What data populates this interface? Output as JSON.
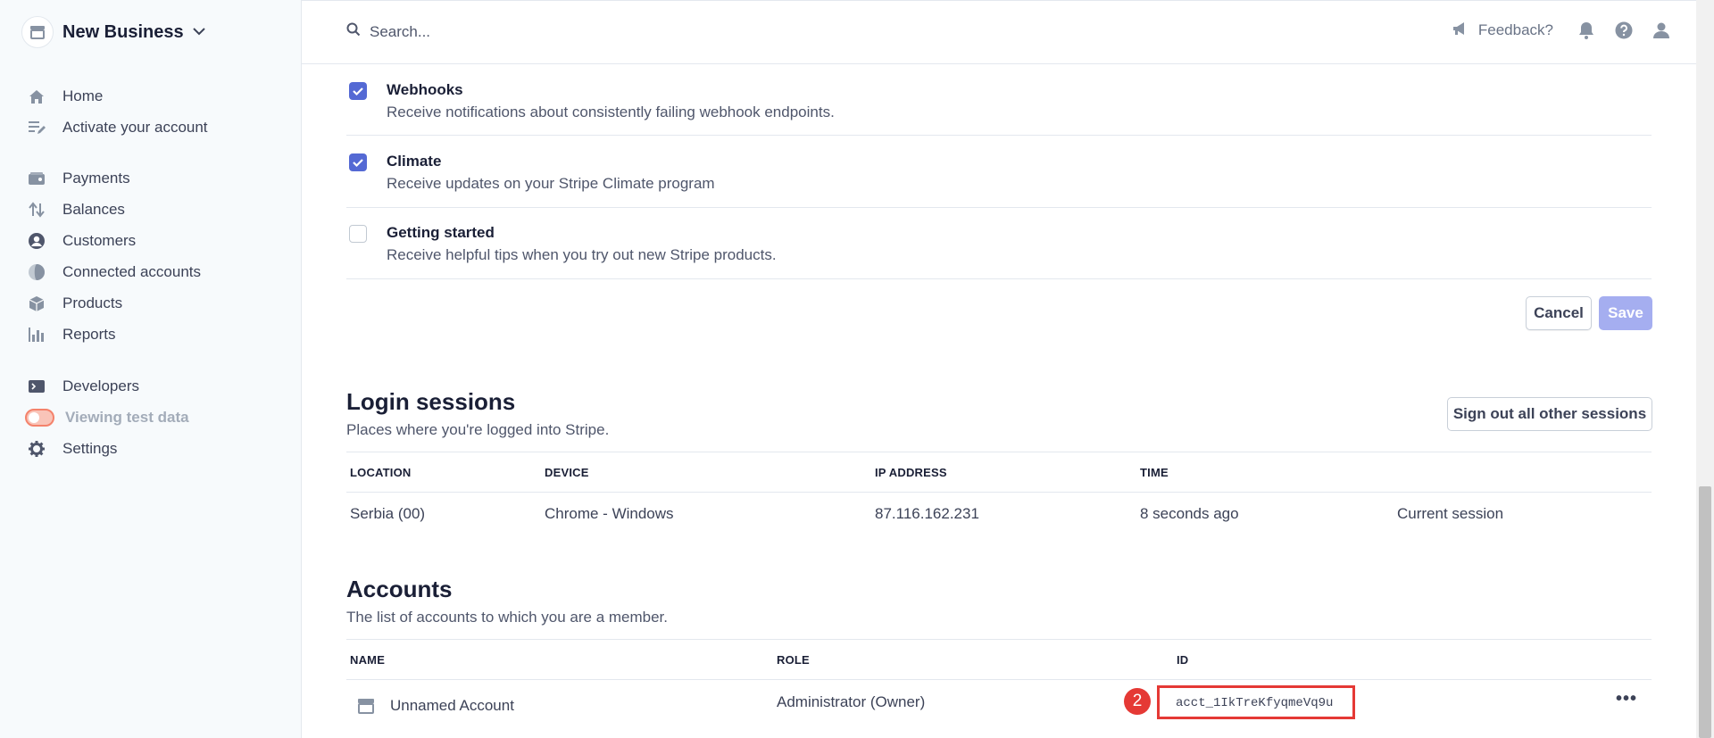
{
  "sidebar": {
    "business_name": "New Business",
    "nav": [
      {
        "label": "Home",
        "icon": "home-icon"
      },
      {
        "label": "Activate your account",
        "icon": "edit-list-icon"
      },
      {
        "label": "Payments",
        "icon": "wallet-icon"
      },
      {
        "label": "Balances",
        "icon": "arrows-updown-icon"
      },
      {
        "label": "Customers",
        "icon": "user-circle-icon"
      },
      {
        "label": "Connected accounts",
        "icon": "globe-icon"
      },
      {
        "label": "Products",
        "icon": "box-icon"
      },
      {
        "label": "Reports",
        "icon": "bar-chart-icon"
      },
      {
        "label": "Developers",
        "icon": "terminal-icon"
      },
      {
        "label": "Viewing test data",
        "icon": "toggle"
      },
      {
        "label": "Settings",
        "icon": "gear-icon"
      }
    ]
  },
  "topbar": {
    "search_placeholder": "Search...",
    "feedback_label": "Feedback?"
  },
  "notifications": [
    {
      "title": "Webhooks",
      "description": "Receive notifications about consistently failing webhook endpoints.",
      "checked": true
    },
    {
      "title": "Climate",
      "description": "Receive updates on your Stripe Climate program",
      "checked": true
    },
    {
      "title": "Getting started",
      "description": "Receive helpful tips when you try out new Stripe products.",
      "checked": false
    }
  ],
  "actions": {
    "cancel": "Cancel",
    "save": "Save"
  },
  "login_sessions": {
    "title": "Login sessions",
    "subtitle": "Places where you're logged into Stripe.",
    "signout_label": "Sign out all other sessions",
    "columns": [
      "LOCATION",
      "DEVICE",
      "IP ADDRESS",
      "TIME"
    ],
    "rows": [
      {
        "location": "Serbia (00)",
        "device": "Chrome - Windows",
        "ip": "87.116.162.231",
        "time": "8 seconds ago",
        "status": "Current session"
      }
    ]
  },
  "accounts": {
    "title": "Accounts",
    "subtitle": "The list of accounts to which you are a member.",
    "columns": [
      "NAME",
      "ROLE",
      "ID"
    ],
    "rows": [
      {
        "name": "Unnamed Account",
        "role": "Administrator (Owner)",
        "id": "acct_1IkTreKfyqmeVq9u"
      }
    ]
  },
  "annotation": {
    "badge": "2",
    "color": "#e53935"
  },
  "colors": {
    "accent": "#5469d4",
    "save_disabled": "#a5aef0"
  }
}
